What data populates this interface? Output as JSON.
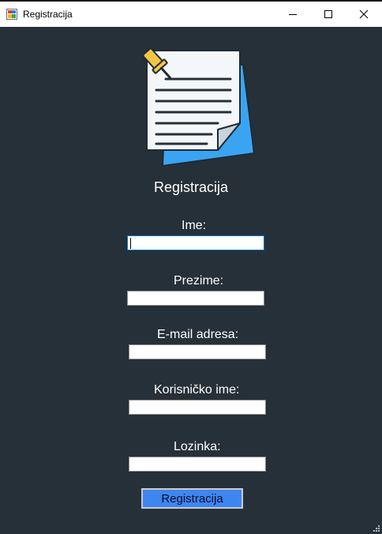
{
  "window": {
    "title": "Registracija",
    "icon": "app-form-icon"
  },
  "header": {
    "illustration": "document-pin-icon",
    "title": "Registracija"
  },
  "form": {
    "fields": [
      {
        "label": "Ime:",
        "value": "",
        "focused": true
      },
      {
        "label": "Prezime:",
        "value": ""
      },
      {
        "label": "E-mail adresa:",
        "value": ""
      },
      {
        "label": "Korisničko ime:",
        "value": ""
      },
      {
        "label": "Lozinka:",
        "value": ""
      }
    ],
    "submit_label": "Registracija"
  },
  "colors": {
    "background": "#263038",
    "button": "#3d86f0",
    "document_accent": "#3aa4f2",
    "pin": "#f5c542"
  }
}
